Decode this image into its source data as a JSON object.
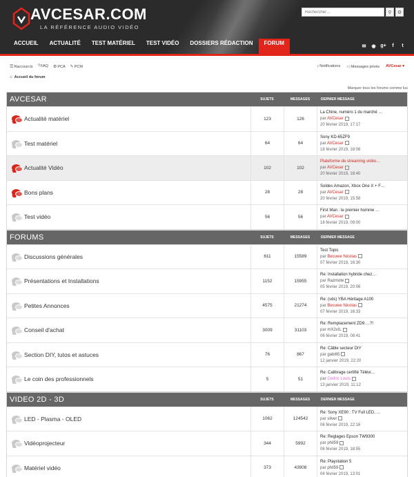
{
  "site": {
    "logo_text": "AVCESAR.COM",
    "logo_sub": "LA RÉFÉRENCE AUDIO VIDÉO",
    "search_placeholder": "Rechercher…"
  },
  "nav": [
    "ACCUEIL",
    "ACTUALITÉ",
    "TEST MATÉRIEL",
    "TEST VIDÉO",
    "DOSSIERS RÉDACTION",
    "FORUM"
  ],
  "active_nav": "FORUM",
  "social": [
    "envelope-icon",
    "rss-icon",
    "googleplus-icon",
    "facebook-icon",
    "twitter-icon"
  ],
  "topbar": {
    "links": [
      "Raccourcis",
      "FAQ",
      "PCA",
      "PCM"
    ],
    "notifications": "Notifications",
    "messages": "Messages privés",
    "user": "AVCesar"
  },
  "breadcrumb": "Accueil du forum",
  "mark_read": "Marquer tous les forums comme lus",
  "colors": {
    "accent": "#e1251b",
    "header_bg": "#2b2b2b",
    "section_bg": "#666666"
  },
  "columns": {
    "topics": "SUJETS",
    "posts": "MESSAGES",
    "last": "DERNIER MESSAGE"
  },
  "sections": [
    {
      "title": "AVCESAR",
      "rows": [
        {
          "name": "Actualité matériel",
          "unread": true,
          "topics": "123",
          "posts": "126",
          "last_title": "La Chine, numéro 1 du marché …",
          "last_title_red": false,
          "by": "AVCesar",
          "by_style": "red",
          "date": "20 février 2019, 17:17",
          "alt": false
        },
        {
          "name": "Test matériel",
          "unread": false,
          "topics": "64",
          "posts": "64",
          "last_title": "Sony KD-65ZF9",
          "last_title_red": false,
          "by": "AVCesar",
          "by_style": "red",
          "date": "18 février 2019, 18:06",
          "alt": false
        },
        {
          "name": "Actualité Vidéo",
          "unread": true,
          "topics": "102",
          "posts": "102",
          "last_title": "Plateforme de streaming vidéo…",
          "last_title_red": true,
          "by": "AVCesar",
          "by_style": "red",
          "date": "20 février 2019, 18:40",
          "alt": true
        },
        {
          "name": "Bons plans",
          "unread": true,
          "topics": "28",
          "posts": "28",
          "last_title": "Soldes Amazon, Xbox One X + F…",
          "last_title_red": false,
          "by": "AVCesar",
          "by_style": "red",
          "date": "20 février 2019, 15:58",
          "alt": false
        },
        {
          "name": "Test vidéo",
          "unread": false,
          "topics": "56",
          "posts": "56",
          "last_title": "First Man : le premier homme …",
          "last_title_red": false,
          "by": "AVCesar",
          "by_style": "red",
          "date": "18 février 2019, 09:00",
          "alt": false
        }
      ]
    },
    {
      "title": "FORUMS",
      "rows": [
        {
          "name": "Discussions générales",
          "unread": false,
          "topics": "611",
          "posts": "15589",
          "last_title": "Test Topic",
          "last_title_red": false,
          "by": "Becuwe Nicolas",
          "by_style": "red",
          "date": "07 février 2019, 16:30",
          "alt": false
        },
        {
          "name": "Présentations et Installations",
          "unread": false,
          "topics": "1152",
          "posts": "15955",
          "last_title": "Re: Installation hybride chez…",
          "last_title_red": false,
          "by": "Razmote",
          "by_style": "grey",
          "date": "05 février 2019, 20:06",
          "alt": false
        },
        {
          "name": "Petites Annonces",
          "unread": false,
          "topics": "4575",
          "posts": "21274",
          "last_title": "Re: (vds) YBA Héritage A100",
          "last_title_red": false,
          "by": "Becuwe Nicolas",
          "by_style": "red",
          "date": "07 février 2019, 16:33",
          "alt": false
        },
        {
          "name": "Conseil d'achat",
          "unread": false,
          "topics": "3009",
          "posts": "31103",
          "last_title": "Re: Remplacement ZD9….?!",
          "last_title_red": false,
          "by": "mX2vIL",
          "by_style": "grey",
          "date": "06 février 2019, 08:41",
          "alt": false
        },
        {
          "name": "Section DIY, tutos et astuces",
          "unread": false,
          "topics": "76",
          "posts": "867",
          "last_title": "Re: Câble secteur DIY",
          "last_title_red": false,
          "by": "gabi65",
          "by_style": "grey",
          "date": "12 janvier 2019, 22:20",
          "alt": false
        },
        {
          "name": "Le coin des professionnels",
          "unread": false,
          "topics": "5",
          "posts": "51",
          "last_title": "Re: Calibrage certifié Télévi…",
          "last_title_red": false,
          "by": "Cedric Louis",
          "by_style": "pink",
          "date": "13 janvier 2019, 11:12",
          "alt": false
        }
      ]
    },
    {
      "title": "VIDEO 2D - 3D",
      "rows": [
        {
          "name": "LED - Plasma - OLED",
          "unread": false,
          "topics": "1062",
          "posts": "124542",
          "last_title": "Re: Sony XE90 : TV Full LED, …",
          "last_title_red": false,
          "by": "silver",
          "by_style": "grey",
          "date": "06 février 2019, 22:16",
          "alt": false
        },
        {
          "name": "Vidéoprojecteur",
          "unread": false,
          "topics": "344",
          "posts": "5992",
          "last_title": "Re: Reglages Epson TW9300",
          "last_title_red": false,
          "by": "phil59",
          "by_style": "grey",
          "date": "06 février 2019, 18:55",
          "alt": false
        },
        {
          "name": "Matériel vidéo",
          "unread": false,
          "topics": "373",
          "posts": "43908",
          "last_title": "Re: Playstation 5",
          "last_title_red": false,
          "by": "phil59",
          "by_style": "grey",
          "date": "04 février 2019, 13:01",
          "alt": false
        }
      ]
    }
  ]
}
